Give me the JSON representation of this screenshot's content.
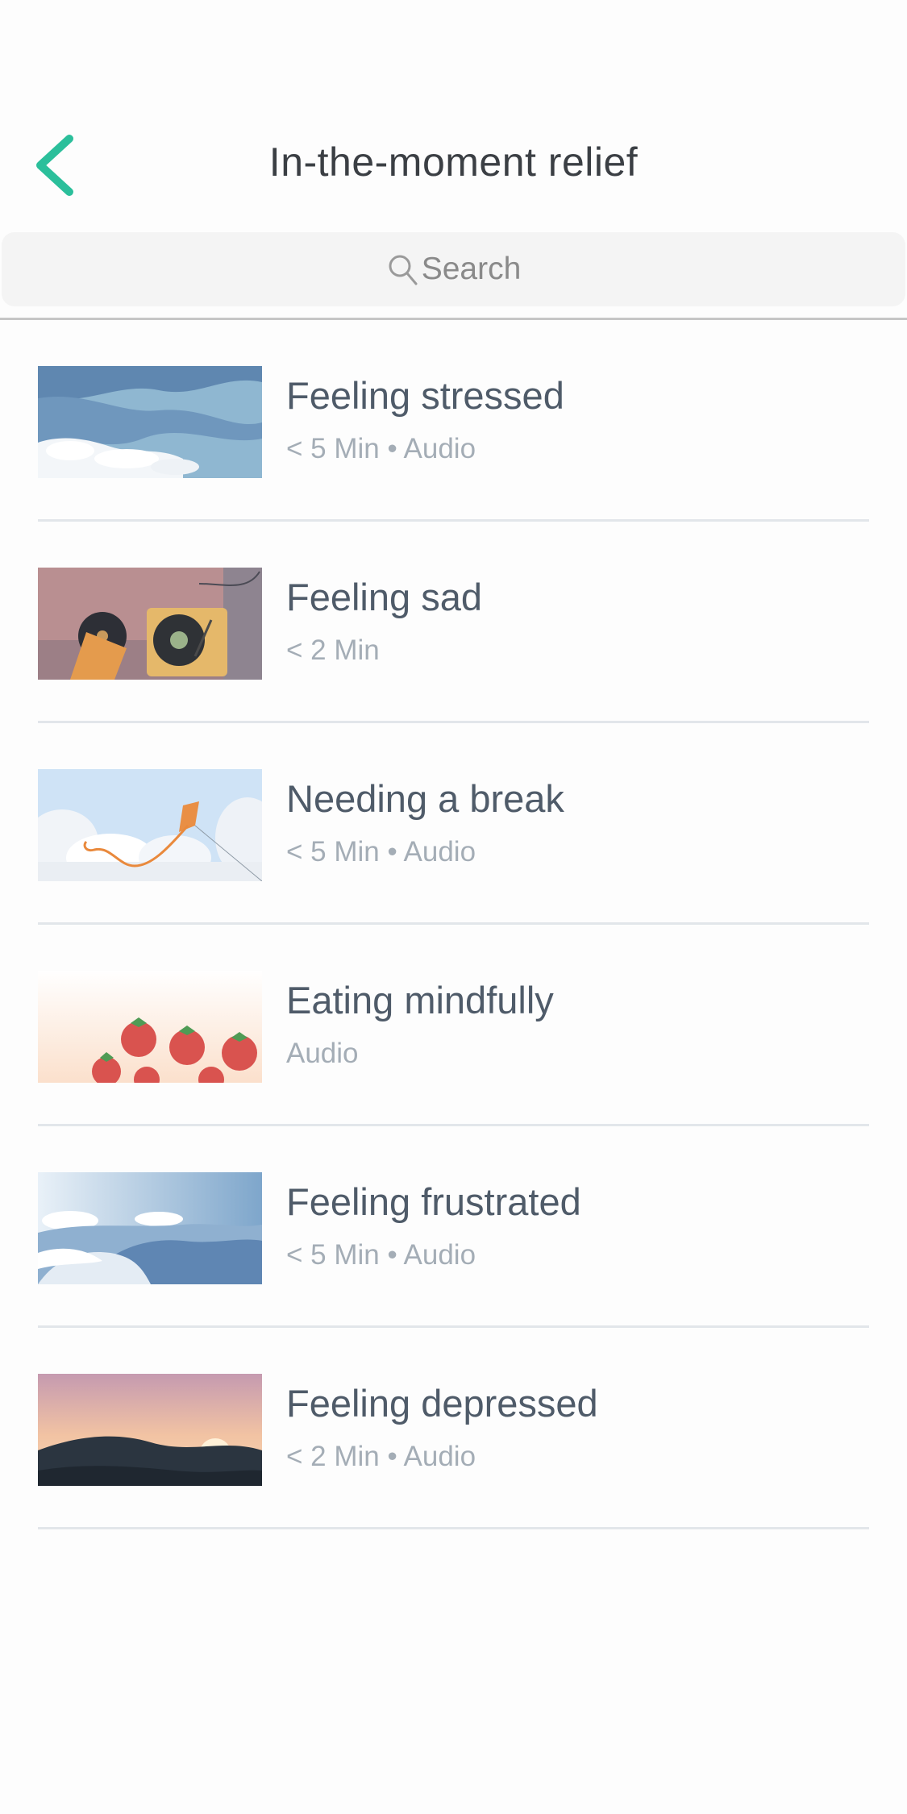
{
  "header": {
    "title": "In-the-moment relief",
    "accent_color": "#2bbf9b",
    "back_icon": "chevron-left-icon"
  },
  "search": {
    "placeholder": "Search",
    "icon": "search-icon"
  },
  "items": [
    {
      "title": "Feeling stressed",
      "meta": "< 5 Min  •  Audio",
      "thumbnail": "waves-illustration"
    },
    {
      "title": "Feeling sad",
      "meta": "< 2 Min",
      "thumbnail": "record-player-illustration"
    },
    {
      "title": "Needing a break",
      "meta": "< 5 Min  •  Audio",
      "thumbnail": "kite-illustration"
    },
    {
      "title": "Eating mindfully",
      "meta": "Audio",
      "thumbnail": "strawberries-illustration"
    },
    {
      "title": "Feeling frustrated",
      "meta": "< 5 Min  •  Audio",
      "thumbnail": "ocean-waves-illustration"
    },
    {
      "title": "Feeling depressed",
      "meta": "< 2 Min  •  Audio",
      "thumbnail": "sunset-hills-illustration"
    }
  ]
}
